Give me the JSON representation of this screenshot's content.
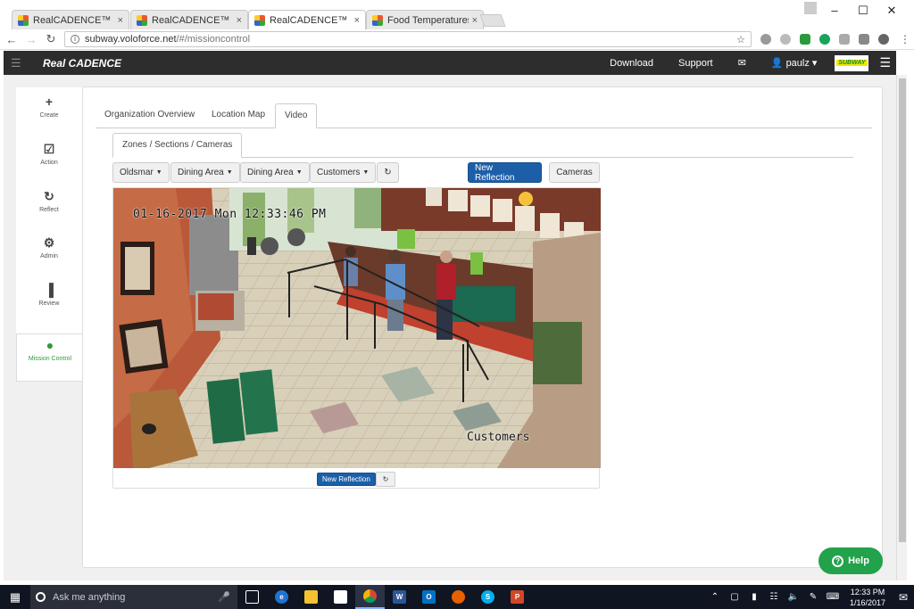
{
  "browser": {
    "tabs": [
      {
        "title": "RealCADENCE™ Brand A",
        "active": false
      },
      {
        "title": "RealCADENCE™ Brand A",
        "active": false
      },
      {
        "title": "RealCADENCE™ Brand A",
        "active": true
      },
      {
        "title": "Food Temperatures - Re",
        "active": false
      }
    ],
    "close_glyph": "×",
    "url_host": "subway.voloforce.net",
    "url_path": "/#/missioncontrol",
    "star_glyph": "☆"
  },
  "appnav": {
    "brand": "Real CADENCE",
    "links": [
      "Download",
      "Support"
    ],
    "mail_icon": "✉",
    "user": "paulz",
    "logo_text": "SUBWAY"
  },
  "sidebar": {
    "items": [
      {
        "label": "Create",
        "icon": "+"
      },
      {
        "label": "Action",
        "icon": "☑"
      },
      {
        "label": "Reflect",
        "icon": "↻"
      },
      {
        "label": "Admin",
        "icon": "⚙"
      },
      {
        "label": "Review",
        "icon": "▐"
      },
      {
        "label": "Mission Control",
        "icon": "●"
      }
    ]
  },
  "main": {
    "tabs": [
      "Organization Overview",
      "Location Map",
      "Video"
    ],
    "subtab": "Zones / Sections / Cameras",
    "filters": [
      "Oldsmar",
      "Dining Area",
      "Dining Area",
      "Customers"
    ],
    "refresh_glyph": "↻",
    "new_reflection": "New Reflection",
    "cameras": "Cameras"
  },
  "video": {
    "timestamp": "01-16-2017 Mon 12:33:46 PM",
    "camera_label": "Customers"
  },
  "help": "Help",
  "taskbar": {
    "search_placeholder": "Ask me anything",
    "time": "12:33 PM",
    "date": "1/16/2017"
  }
}
